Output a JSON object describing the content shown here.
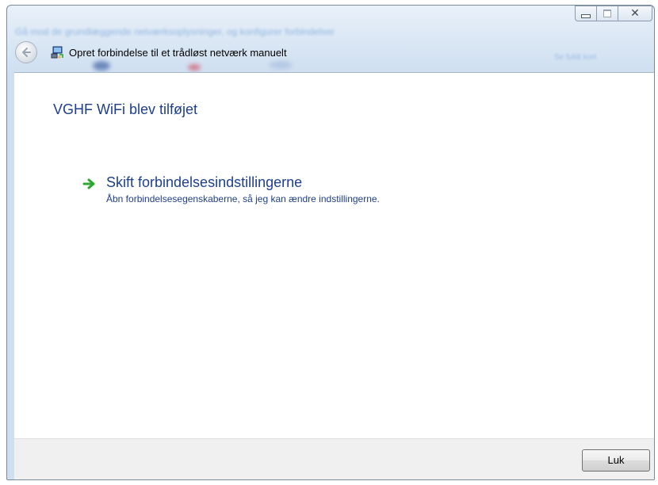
{
  "window": {
    "title": "Opret forbindelse til et trådløst netværk manuelt",
    "background_blur_text": "Gå mod de grundlæggende netværksoplysninger, og konfigurer forbindelser",
    "background_blur_right": "Se fuldt kort"
  },
  "content": {
    "heading": "VGHF WiFi blev tilføjet",
    "task": {
      "title": "Skift forbindelsesindstillingerne",
      "description": "Åbn forbindelsesegenskaberne, så jeg kan ændre indstillingerne."
    }
  },
  "footer": {
    "close_label": "Luk"
  },
  "icons": {
    "back": "back-arrow-icon",
    "header": "wireless-network-icon",
    "task": "green-arrow-icon",
    "minimize": "minimize-icon",
    "maximize": "maximize-icon",
    "close": "close-icon"
  },
  "colors": {
    "heading": "#1e3f8c",
    "task_arrow": "#2ea82e",
    "frame": "#dce8f5"
  }
}
